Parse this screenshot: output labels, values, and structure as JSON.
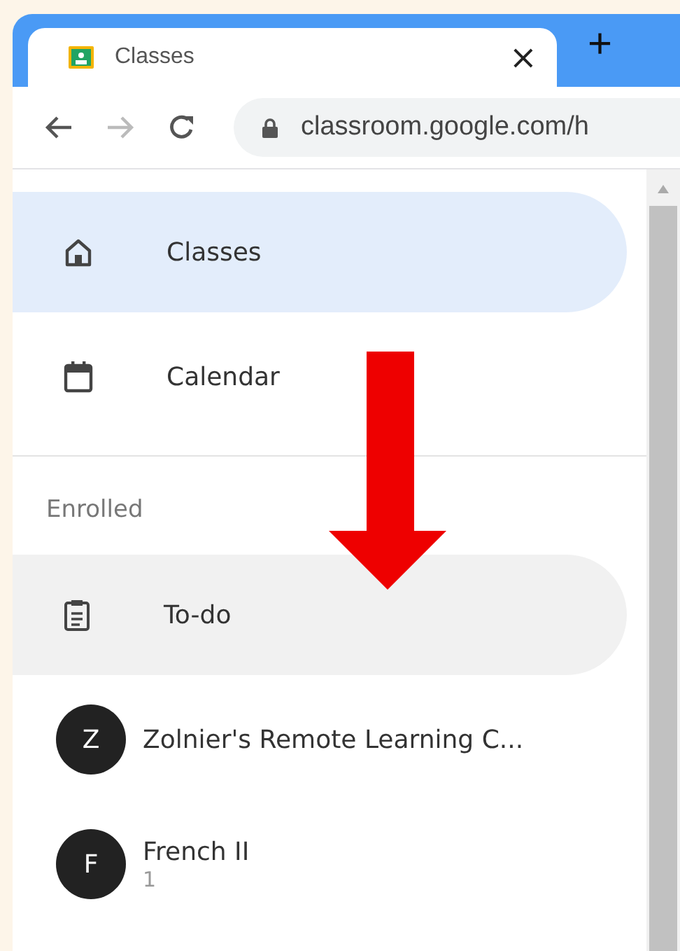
{
  "browser": {
    "tab": {
      "title": "Classes",
      "close": "×"
    },
    "new_tab": "+",
    "address": "classroom.google.com/h"
  },
  "nav": [
    {
      "label": "Classes",
      "kind": "home",
      "selected": true
    },
    {
      "label": "Calendar",
      "kind": "calendar",
      "selected": false
    }
  ],
  "section": "Enrolled",
  "enrolled": [
    {
      "kind": "todo",
      "label": "To-do",
      "highlighted": true
    },
    {
      "kind": "class",
      "avatar": "Z",
      "label": "Zolnier's Remote Learning C...",
      "highlighted": false
    },
    {
      "kind": "class",
      "avatar": "F",
      "label": "French II",
      "subtitle": "1",
      "highlighted": false
    }
  ]
}
